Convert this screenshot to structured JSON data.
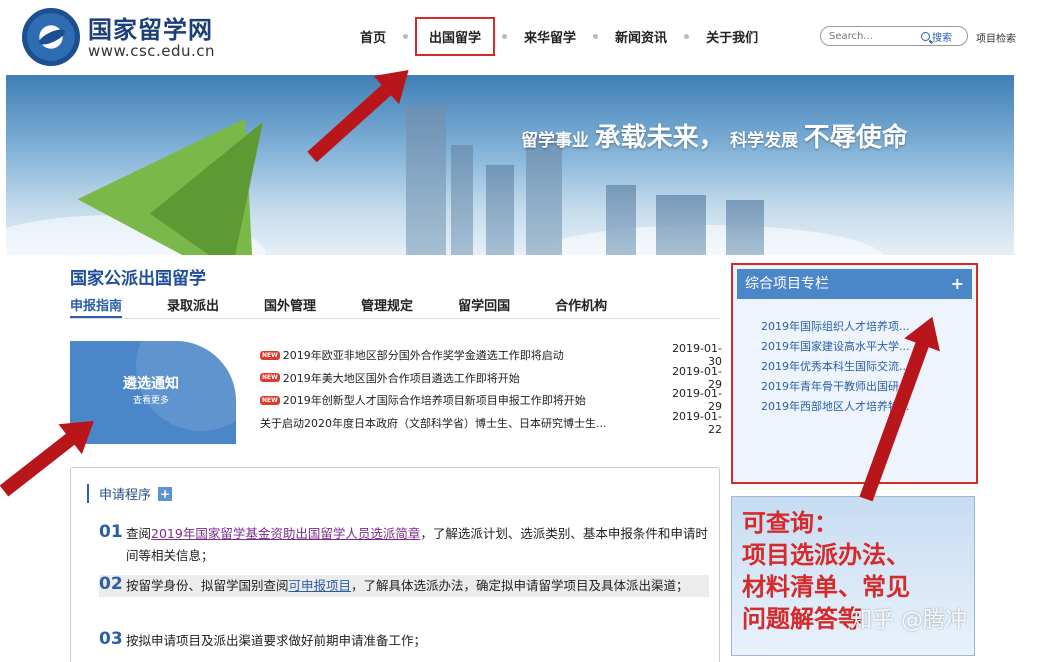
{
  "header": {
    "logo_title": "国家留学网",
    "logo_url": "www.csc.edu.cn",
    "nav": [
      "首页",
      "出国留学",
      "来华留学",
      "新闻资讯",
      "关于我们"
    ],
    "search_placeholder": "Search...",
    "search_button": "搜索",
    "project_search": "项目检索"
  },
  "banner": {
    "slogan_part1": "留学事业",
    "slogan_part2": "承载未来，",
    "slogan_part3": "科学发展",
    "slogan_part4": "不辱使命"
  },
  "main": {
    "section_title": "国家公派出国留学",
    "tabs": [
      "申报指南",
      "录取派出",
      "国外管理",
      "管理规定",
      "留学回国",
      "合作机构"
    ],
    "notice_card": {
      "title": "遴选通知",
      "more": "查看更多"
    },
    "news": [
      {
        "badge": "NEW",
        "title": "2019年欧亚非地区部分国外合作奖学金遴选工作即将启动",
        "date": "2019-01-30"
      },
      {
        "badge": "NEW",
        "title": "2019年美大地区国外合作项目遴选工作即将开始",
        "date": "2019-01-29"
      },
      {
        "badge": "NEW",
        "title": "2019年创新型人才国际合作培养项目新项目申报工作即将开始",
        "date": "2019-01-29"
      },
      {
        "badge": "",
        "title": "关于启动2020年度日本政府（文部科学省）博士生、日本研究博士生...",
        "date": "2019-01-22"
      }
    ],
    "procedure": {
      "title": "申请程序",
      "steps": [
        {
          "num": "01",
          "pre": "查阅",
          "link": "2019年国家留学基金资助出国留学人员选派简章",
          "post": "，了解选派计划、选派类别、基本申报条件和申请时间等相关信息；"
        },
        {
          "num": "02",
          "pre": "按留学身份、拟留学国别查阅",
          "link": "可申报项目",
          "post": "，了解具体选派办法，确定拟申请留学项目及具体派出渠道；"
        },
        {
          "num": "03",
          "pre": "按拟申请项目及派出渠道要求做好前期申请准备工作；",
          "link": "",
          "post": ""
        }
      ]
    }
  },
  "side": {
    "title": "综合项目专栏",
    "plus": "+",
    "items": [
      "2019年国际组织人才培养项...",
      "2019年国家建设高水平大学...",
      "2019年优秀本科生国际交流...",
      "2019年青年骨干教师出国研...",
      "2019年西部地区人才培养特..."
    ]
  },
  "annotation": {
    "lines": [
      "可查询：",
      "项目选派办法、",
      "材料清单、常见",
      "问题解答等"
    ]
  },
  "watermark": "知乎 @腾冲"
}
